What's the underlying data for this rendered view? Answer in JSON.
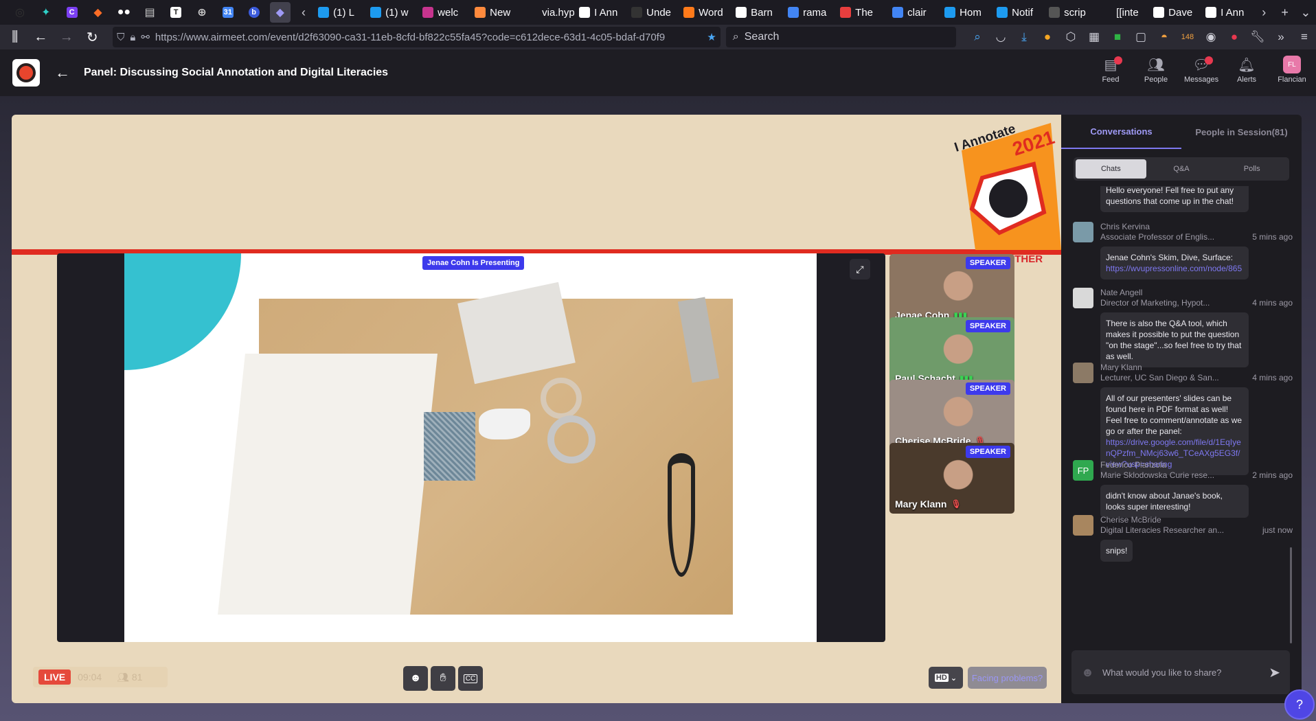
{
  "browser": {
    "tabs": [
      {
        "label": "(1) L",
        "icon": "twitter-icon",
        "color": "#1d9bf0"
      },
      {
        "label": "(1) w",
        "icon": "twitter-icon",
        "color": "#1d9bf0"
      },
      {
        "label": "welc",
        "icon": "badge-69-icon",
        "color": "#c7348e"
      },
      {
        "label": "New",
        "icon": "firefox-icon",
        "color": "#ff8a3d"
      },
      {
        "label": "via.hyp",
        "icon": "blank-icon",
        "color": "#1c1b22"
      },
      {
        "label": "I Ann",
        "icon": "ia-icon",
        "color": "#ffffff"
      },
      {
        "label": "Unde",
        "icon": "u-icon",
        "color": "#333333"
      },
      {
        "label": "Word",
        "icon": "heart-icon",
        "color": "#ff7a1a"
      },
      {
        "label": "Barn",
        "icon": "wikipedia-icon",
        "color": "#ffffff"
      },
      {
        "label": "rama",
        "icon": "google-icon",
        "color": "#4285f4"
      },
      {
        "label": "The",
        "icon": "comment-icon",
        "color": "#e83e3e"
      },
      {
        "label": "clair",
        "icon": "google-icon",
        "color": "#4285f4"
      },
      {
        "label": "Hom",
        "icon": "twitter-icon",
        "color": "#1d9bf0"
      },
      {
        "label": "Notif",
        "icon": "twitter-icon",
        "color": "#1d9bf0"
      },
      {
        "label": "scrip",
        "icon": "loading-icon",
        "color": "#555555"
      },
      {
        "label": "[[inte",
        "icon": "blank-icon",
        "color": "#1c1b22"
      },
      {
        "label": "Dave",
        "icon": "wikipedia-icon",
        "color": "#ffffff"
      },
      {
        "label": "I Ann",
        "icon": "ia-icon",
        "color": "#ffffff"
      }
    ],
    "url": "https://www.airmeet.com/event/d2f63090-ca31-11eb-8cfd-bf822c55fa45?code=c612dece-63d1-4c05-bdaf-d70f9",
    "search_placeholder": "Search",
    "badge_count": "148"
  },
  "header": {
    "title": "Panel: Discussing Social Annotation and Digital Literacies",
    "nav": [
      {
        "label": "Feed",
        "icon": "feed-icon",
        "dot": true
      },
      {
        "label": "People",
        "icon": "people-icon",
        "dot": false
      },
      {
        "label": "Messages",
        "icon": "messages-icon",
        "dot": true
      },
      {
        "label": "Alerts",
        "icon": "bell-icon",
        "dot": false
      },
      {
        "label": "Flancian",
        "icon": "avatar",
        "dot": false
      }
    ],
    "avatar_initials": "FL"
  },
  "stage": {
    "presenting_label": "Jenae Cohn Is Presenting",
    "logo_text_top": "I Annotate",
    "logo_year": "2021",
    "logo_tagline": "TOGETHER",
    "speakers": [
      {
        "name": "Jenae Cohn",
        "badge": "SPEAKER",
        "mic": "on",
        "bg": "#8c7561"
      },
      {
        "name": "Paul Schacht",
        "badge": "SPEAKER",
        "mic": "on",
        "bg": "#6f9b6a"
      },
      {
        "name": "Cherise McBride",
        "badge": "SPEAKER",
        "mic": "off",
        "bg": "#9b8d85"
      },
      {
        "name": "Mary Klann",
        "badge": "SPEAKER",
        "mic": "off",
        "bg": "#4a3a2c"
      }
    ],
    "live_label": "LIVE",
    "live_time": "09:04",
    "attendee_count": "81",
    "hd_label": "HD",
    "facing_problems": "Facing problems?"
  },
  "panel": {
    "tabs": [
      "Conversations",
      "People in Session(81)"
    ],
    "subtabs": [
      "Chats",
      "Q&A",
      "Polls"
    ],
    "messages": [
      {
        "name": "",
        "role": "",
        "time": "",
        "text": "Hello everyone! Fell free to put any questions that come up in the chat!",
        "link": "",
        "avatar": ""
      },
      {
        "name": "Chris Kervina",
        "role": "Associate Professor of Englis...",
        "time": "5 mins ago",
        "text": "Jenae Cohn's Skim, Dive, Surface:",
        "link": "https://wvupressonline.com/node/865",
        "avatar": "#7a9aa8"
      },
      {
        "name": "Nate Angell",
        "role": "Director of Marketing, Hypot...",
        "time": "4 mins ago",
        "text": "There is also the Q&A tool, which makes it possible to put the question \"on the stage\"...so feel free to try that as well.",
        "link": "",
        "avatar": "#d9d9d9"
      },
      {
        "name": "Mary Klann",
        "role": "Lecturer, UC San Diego & San...",
        "time": "4 mins ago",
        "text": "All of our presenters' slides can be found here in PDF format as well! Feel free to comment/annotate as we go or after the panel:",
        "link": "https://drive.google.com/file/d/1EqIyenQPzfm_NMcj63w6_TCeAXg5EG3f/view?usp=sharing",
        "avatar": "#8c7a66"
      },
      {
        "name": "Federico Pianzola",
        "role": "Marie Sklodowska Curie rese...",
        "time": "2 mins ago",
        "text": "didn't know about Janae's book, looks super interesting!",
        "link": "",
        "avatar": "#2fa84f",
        "initials": "FP"
      },
      {
        "name": "Cherise McBride",
        "role": "Digital Literacies Researcher an...",
        "time": "just now",
        "text": "snips!",
        "link": "",
        "avatar": "#a8865f"
      }
    ],
    "input_placeholder": "What would you like to share?"
  }
}
